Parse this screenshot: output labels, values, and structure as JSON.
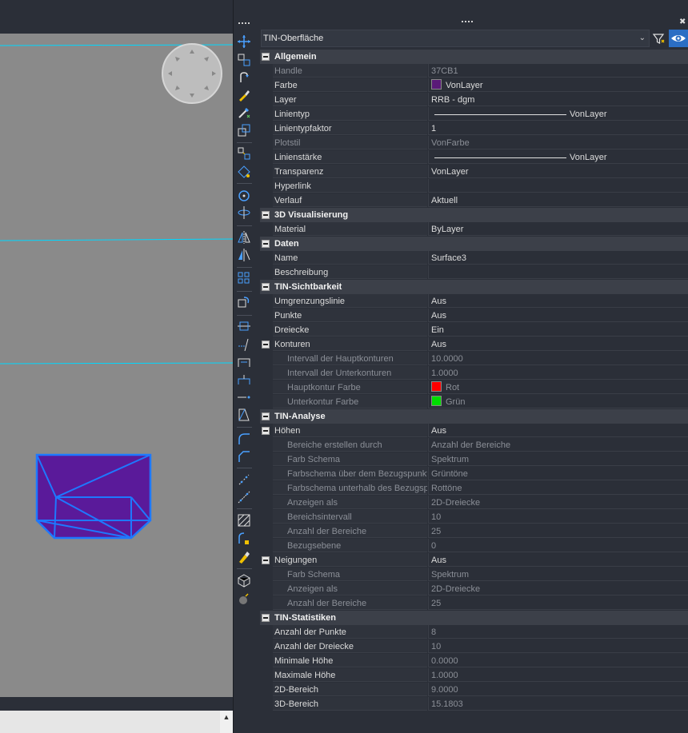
{
  "panel": {
    "object_type": "TIN-Oberfläche"
  },
  "colors": {
    "farbe_swatch": "#5a1a78",
    "hauptkontur": "#ff0000",
    "unterkontur": "#00dd00",
    "accent": "#2b6ec4",
    "surface_fill": "#5a1a9a",
    "surface_edge": "#1e78ff"
  },
  "icons": {
    "filter": "quick-select-filter-icon",
    "eye": "toggle-pickadd-eye-icon",
    "collapse": "collapse-minus-icon"
  },
  "sections": [
    {
      "title": "Allgemein",
      "rows": [
        {
          "name": "Handle",
          "value": "37CB1",
          "dim": true
        },
        {
          "name": "Farbe",
          "value": "VonLayer",
          "swatch": "#5a1a78"
        },
        {
          "name": "Layer",
          "value": "RRB - dgm"
        },
        {
          "name": "Linientyp",
          "value": "VonLayer",
          "line": 165
        },
        {
          "name": "Linientypfaktor",
          "value": "1"
        },
        {
          "name": "Plotstil",
          "value": "VonFarbe",
          "dim": true
        },
        {
          "name": "Linienstärke",
          "value": "VonLayer",
          "line": 165
        },
        {
          "name": "Transparenz",
          "value": "VonLayer"
        },
        {
          "name": "Hyperlink",
          "value": ""
        },
        {
          "name": "Verlauf",
          "value": "Aktuell"
        }
      ]
    },
    {
      "title": "3D Visualisierung",
      "rows": [
        {
          "name": "Material",
          "value": "ByLayer"
        }
      ]
    },
    {
      "title": "Daten",
      "rows": [
        {
          "name": "Name",
          "value": "Surface3"
        },
        {
          "name": "Beschreibung",
          "value": ""
        }
      ]
    },
    {
      "title": "TIN-Sichtbarkeit",
      "rows": [
        {
          "name": "Umgrenzungslinie",
          "value": "Aus"
        },
        {
          "name": "Punkte",
          "value": "Aus"
        },
        {
          "name": "Dreiecke",
          "value": "Ein"
        },
        {
          "name": "Konturen",
          "value": "Aus",
          "sub": true
        },
        {
          "name": "Intervall der Hauptkonturen",
          "value": "10.0000",
          "dim": true,
          "indent": true
        },
        {
          "name": "Intervall der Unterkonturen",
          "value": "1.0000",
          "dim": true,
          "indent": true
        },
        {
          "name": "Hauptkontur Farbe",
          "value": "Rot",
          "dim": true,
          "indent": true,
          "swatch": "#ff0000"
        },
        {
          "name": "Unterkontur Farbe",
          "value": "Grün",
          "dim": true,
          "indent": true,
          "swatch": "#00dd00"
        }
      ]
    },
    {
      "title": "TIN-Analyse",
      "rows": [
        {
          "name": "Höhen",
          "value": "Aus",
          "sub": true
        },
        {
          "name": "Bereiche erstellen durch",
          "value": "Anzahl der Bereiche",
          "dim": true,
          "indent": true
        },
        {
          "name": "Farb Schema",
          "value": "Spektrum",
          "dim": true,
          "indent": true
        },
        {
          "name": "Farbschema über dem Bezugspunkt",
          "value": "Grüntöne",
          "dim": true,
          "indent": true
        },
        {
          "name": "Farbschema unterhalb des Bezugspunkts",
          "value": "Rottöne",
          "dim": true,
          "indent": true
        },
        {
          "name": "Anzeigen als",
          "value": "2D-Dreiecke",
          "dim": true,
          "indent": true
        },
        {
          "name": "Bereichsintervall",
          "value": "10",
          "dim": true,
          "indent": true
        },
        {
          "name": "Anzahl der Bereiche",
          "value": "25",
          "dim": true,
          "indent": true
        },
        {
          "name": "Bezugsebene",
          "value": "0",
          "dim": true,
          "indent": true
        },
        {
          "name": "Neigungen",
          "value": "Aus",
          "sub": true
        },
        {
          "name": "Farb Schema",
          "value": "Spektrum",
          "dim": true,
          "indent": true
        },
        {
          "name": "Anzeigen als",
          "value": "2D-Dreiecke",
          "dim": true,
          "indent": true
        },
        {
          "name": "Anzahl der Bereiche",
          "value": "25",
          "dim": true,
          "indent": true
        }
      ]
    },
    {
      "title": "TIN-Statistiken",
      "rows": [
        {
          "name": "Anzahl der Punkte",
          "value": "8",
          "dimval": true
        },
        {
          "name": "Anzahl der Dreiecke",
          "value": "10",
          "dimval": true
        },
        {
          "name": "Minimale Höhe",
          "value": "0.0000",
          "dimval": true
        },
        {
          "name": "Maximale Höhe",
          "value": "1.0000",
          "dimval": true
        },
        {
          "name": "2D-Bereich",
          "value": "9.0000",
          "dimval": true
        },
        {
          "name": "3D-Bereich",
          "value": "15.1803",
          "dimval": true
        }
      ]
    }
  ],
  "toolbar": {
    "tools": [
      "move-icon",
      "copy-icon",
      "rotate-copy-icon",
      "matchprop-brush-icon",
      "pick-style-icon",
      "scale-icon",
      "align-icon",
      "stretch-icon",
      "rotate-icon",
      "rotate3d-icon",
      "mirror-icon",
      "mirror3d-icon",
      "array-icon",
      "offset-icon",
      "break-icon",
      "trim-icon",
      "extend-icon",
      "join-icon",
      "lengthen-icon",
      "taper-icon",
      "fillet-icon",
      "chamfer-icon",
      "explode-icon",
      "explode-all-icon",
      "hatch-icon",
      "curve-edit-icon",
      "paint-icon",
      "solid-edit-icon",
      "bomb-icon"
    ]
  }
}
